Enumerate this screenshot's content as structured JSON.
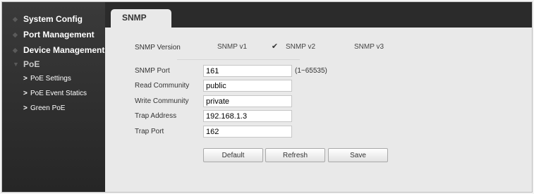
{
  "sidebar": {
    "items": [
      {
        "label": "System Config",
        "icon": "bullet-icon"
      },
      {
        "label": "Port Management",
        "icon": "bullet-icon"
      },
      {
        "label": "Device Management",
        "icon": "bullet-icon"
      },
      {
        "label": "PoE",
        "icon": "expand-icon"
      }
    ],
    "subitems": [
      {
        "label": "PoE Settings",
        "icon": ">"
      },
      {
        "label": "PoE Event Statics",
        "icon": ">"
      },
      {
        "label": "Green PoE",
        "icon": ">"
      }
    ]
  },
  "tab": {
    "label": "SNMP"
  },
  "form": {
    "version": {
      "label": "SNMP Version",
      "options": [
        {
          "label": "SNMP v1",
          "checked": false
        },
        {
          "label": "SNMP v2",
          "checked": true
        },
        {
          "label": "SNMP v3",
          "checked": false
        }
      ]
    },
    "port": {
      "label": "SNMP Port",
      "value": "161",
      "hint": "(1~65535)"
    },
    "read_community": {
      "label": "Read Community",
      "value": "public"
    },
    "write_community": {
      "label": "Write Community",
      "value": "private"
    },
    "trap_address": {
      "label": "Trap Address",
      "value": "192.168.1.3"
    },
    "trap_port": {
      "label": "Trap Port",
      "value": "162"
    }
  },
  "buttons": {
    "default": "Default",
    "refresh": "Refresh",
    "save": "Save"
  },
  "check_mark": "✔",
  "colors": {
    "sidebar_bg": "#2b2b2b",
    "content_bg": "#e9e9e9",
    "text": "#333333"
  }
}
